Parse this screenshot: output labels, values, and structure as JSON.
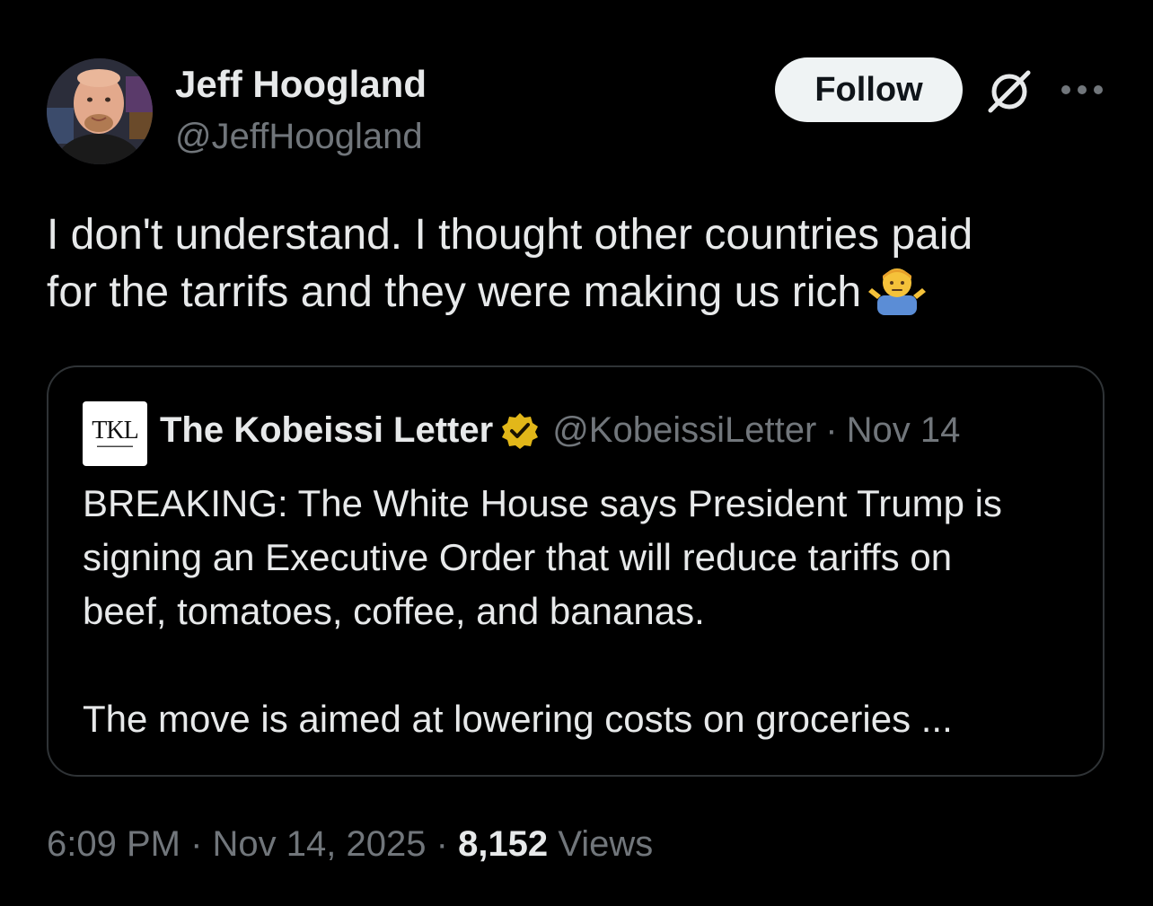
{
  "author": {
    "display_name": "Jeff Hoogland",
    "handle": "@JeffHoogland"
  },
  "actions": {
    "follow_label": "Follow"
  },
  "tweet": {
    "text_lines": [
      "I don't understand. I thought other countries paid",
      "for the tarrifs and they were making us rich"
    ],
    "emoji": "person-shrugging"
  },
  "quote": {
    "logo_text": "TKL",
    "display_name": "The Kobeissi Letter",
    "handle": "@KobeissiLetter",
    "separator": "·",
    "date": "Nov 14",
    "text_lines": [
      "BREAKING: The White House says President Trump is",
      "signing an Executive Order that will reduce tariffs on",
      "beef, tomatoes, coffee, and bananas."
    ],
    "text_line_2": "The move is aimed at lowering costs on groceries ..."
  },
  "meta": {
    "time": "6:09 PM",
    "separator": "·",
    "date": "Nov 14, 2025",
    "separator_2": "·",
    "views_count": "8,152",
    "views_label": "Views"
  },
  "colors": {
    "background": "#000000",
    "text_primary": "#e7e9ea",
    "text_secondary": "#71767b",
    "border": "#2f3336",
    "follow_bg": "#eff3f4",
    "verified_gold": "#e2b719"
  },
  "icons": [
    "grok-icon",
    "more-options-icon",
    "verified-badge-icon",
    "shrug-emoji-icon"
  ]
}
